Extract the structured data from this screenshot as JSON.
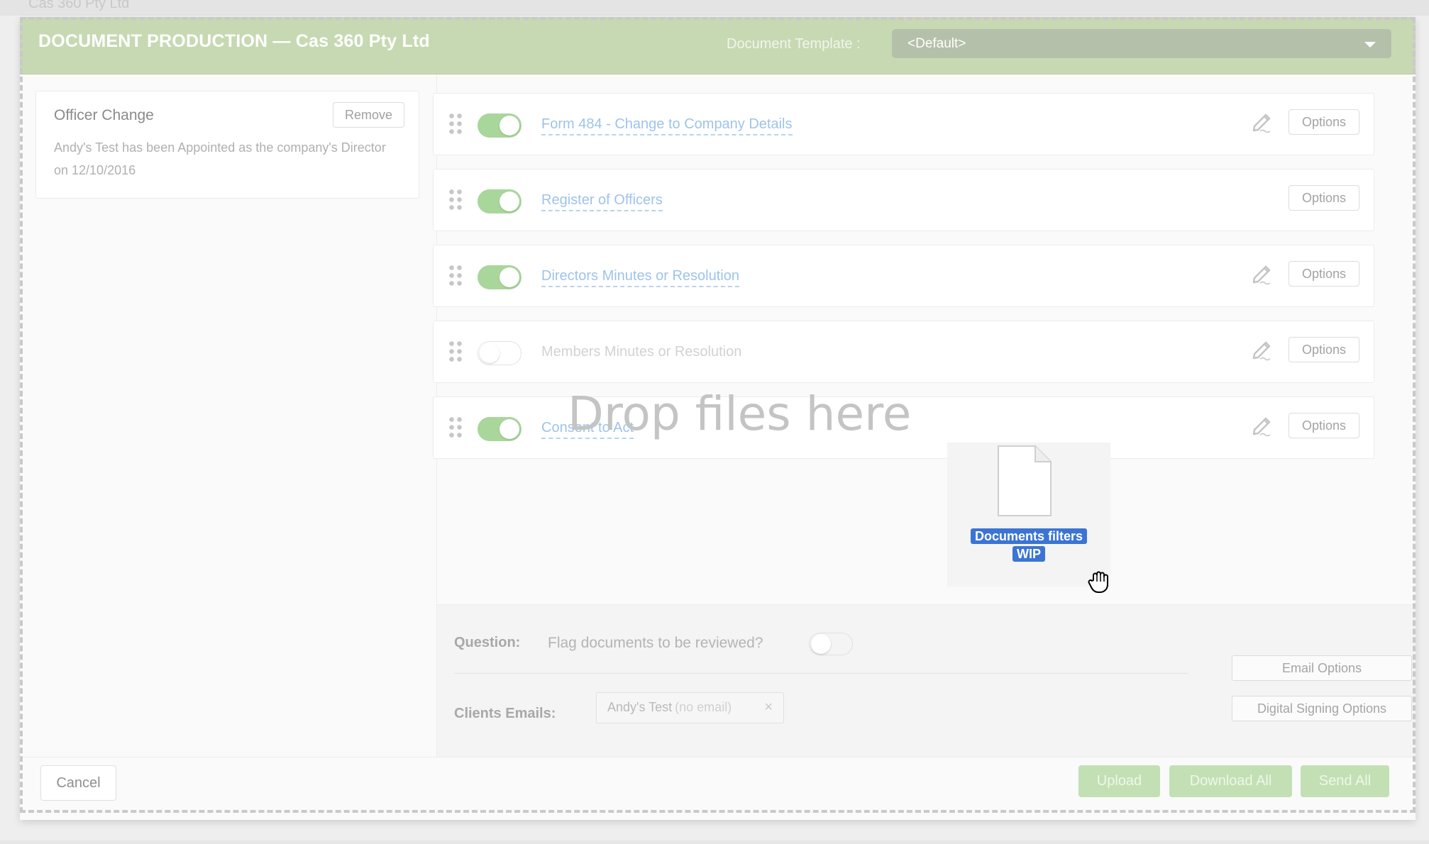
{
  "header": {
    "title": "DOCUMENT PRODUCTION — Cas 360 Pty Ltd",
    "template_label": "Document Template :",
    "template_value": "<Default>"
  },
  "background_title": "Cas 360 Pty Ltd",
  "change": {
    "title": "Officer Change",
    "remove_label": "Remove",
    "description": "Andy's Test has been Appointed as the company's Director on 12/10/2016"
  },
  "documents": [
    {
      "name": "Form 484 - Change to Company Details",
      "enabled": true,
      "has_sign": true,
      "options_label": "Options"
    },
    {
      "name": "Register of Officers",
      "enabled": true,
      "has_sign": false,
      "options_label": "Options"
    },
    {
      "name": "Directors Minutes or Resolution",
      "enabled": true,
      "has_sign": true,
      "options_label": "Options"
    },
    {
      "name": "Members Minutes or Resolution",
      "enabled": false,
      "has_sign": true,
      "options_label": "Options"
    },
    {
      "name": "Consent to Act",
      "enabled": true,
      "has_sign": true,
      "options_label": "Options"
    }
  ],
  "dropzone": {
    "text": "Drop files here",
    "dragged_file_line1": "Documents filters",
    "dragged_file_line2": "WIP"
  },
  "question": {
    "label": "Question:",
    "text": "Flag documents to be reviewed?",
    "enabled": false
  },
  "clients_emails": {
    "label": "Clients Emails:",
    "chip_name": "Andy's Test",
    "chip_note": "(no email)",
    "chip_remove": "×"
  },
  "side_buttons": {
    "email_options": "Email Options",
    "digital_signing_options": "Digital Signing Options"
  },
  "footer": {
    "cancel": "Cancel",
    "upload": "Upload",
    "download_all": "Download All",
    "send_all": "Send All"
  },
  "colors": {
    "header_green": "#c7d9b3",
    "toggle_on": "#a9d69b",
    "link_blue": "#9fc3ea",
    "action_green": "#c3e0b5",
    "drag_label_blue": "#3b74d3"
  }
}
